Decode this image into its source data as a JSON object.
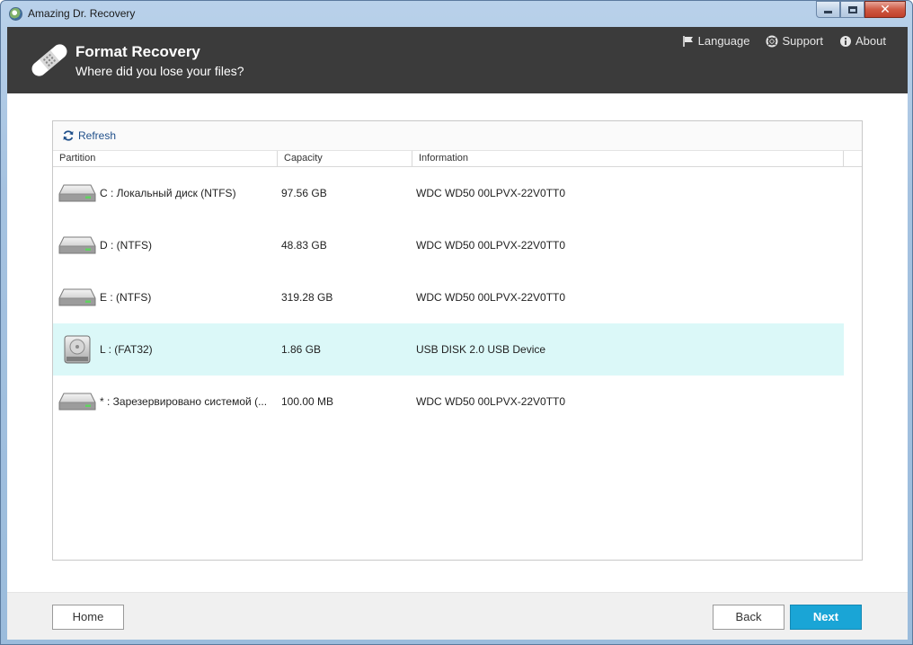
{
  "window": {
    "title": "Amazing Dr. Recovery"
  },
  "header": {
    "title": "Format Recovery",
    "subtitle": "Where did you lose your files?",
    "links": {
      "language": "Language",
      "support": "Support",
      "about": "About"
    }
  },
  "toolbar": {
    "refresh_label": "Refresh"
  },
  "table": {
    "columns": {
      "partition": "Partition",
      "capacity": "Capacity",
      "information": "Information"
    },
    "rows": [
      {
        "partition": "C : Локальный диск  (NTFS)",
        "capacity": "97.56 GB",
        "information": "WDC WD50  00LPVX-22V0TT0",
        "icon": "hard-drive-icon",
        "selected": false
      },
      {
        "partition": "D :   (NTFS)",
        "capacity": "48.83 GB",
        "information": "WDC WD50  00LPVX-22V0TT0",
        "icon": "hard-drive-icon",
        "selected": false
      },
      {
        "partition": "E :   (NTFS)",
        "capacity": "319.28 GB",
        "information": "WDC WD50  00LPVX-22V0TT0",
        "icon": "hard-drive-icon",
        "selected": false
      },
      {
        "partition": "L :   (FAT32)",
        "capacity": "1.86 GB",
        "information": "USB DISK 2.0   USB Device",
        "icon": "usb-drive-icon",
        "selected": true
      },
      {
        "partition": "* : Зарезервировано системой  (...",
        "capacity": "100.00 MB",
        "information": "WDC WD50  00LPVX-22V0TT0",
        "icon": "hard-drive-icon",
        "selected": false
      }
    ]
  },
  "footer": {
    "home_label": "Home",
    "back_label": "Back",
    "next_label": "Next"
  },
  "colors": {
    "header_bg": "#3b3b3b",
    "selected_row": "#dbf8f8",
    "accent": "#1aa5d6"
  }
}
